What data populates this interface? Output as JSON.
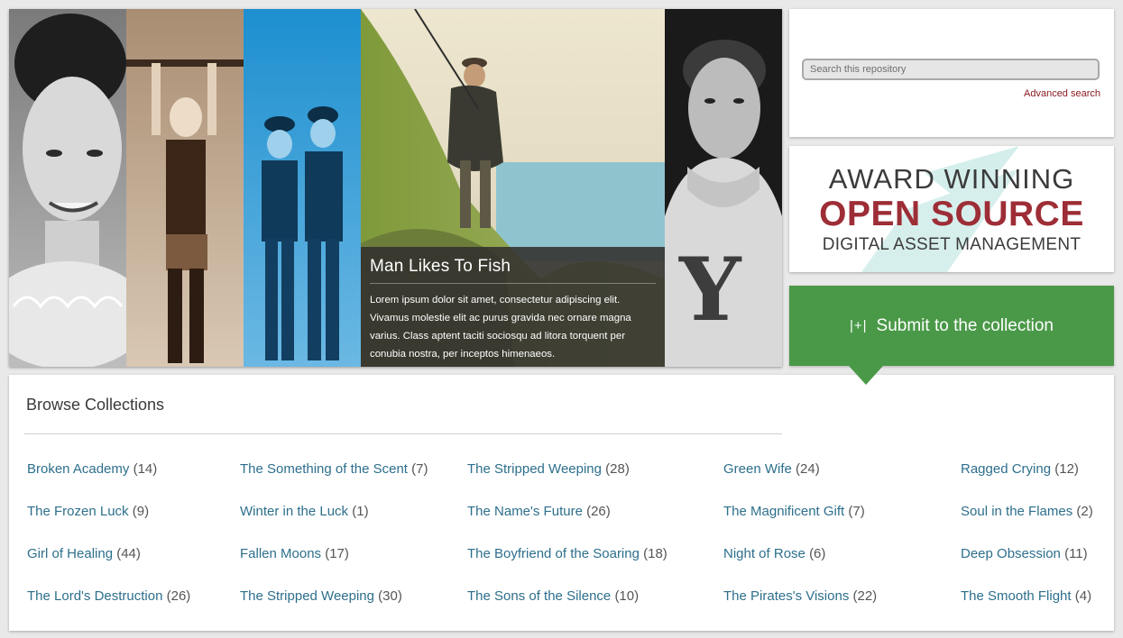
{
  "hero": {
    "panels": [
      {
        "name": "smiling-woman-photo",
        "tone": "grayscale"
      },
      {
        "name": "boy-on-bar-photo",
        "tone": "sepia"
      },
      {
        "name": "two-men-photo",
        "tone": "blue"
      },
      {
        "name": "man-fishing-photo",
        "tone": "color"
      },
      {
        "name": "yale-sweater-man-photo",
        "tone": "grayscale"
      }
    ],
    "caption": {
      "title": "Man Likes To Fish",
      "body": "Lorem ipsum dolor sit amet, consectetur adipiscing elit. Vivamus molestie elit ac purus gravida nec ornare magna varius. Class aptent taciti sociosqu ad litora torquent per conubia nostra, per inceptos himenaeos."
    },
    "sweater_letter": "Y"
  },
  "search": {
    "placeholder": "Search this repository",
    "advanced_link": "Advanced search"
  },
  "award": {
    "line1": "AWARD WINNING",
    "line2": "OPEN SOURCE",
    "line3": "DIGITAL ASSET MANAGEMENT"
  },
  "submit": {
    "icon": "|+|",
    "label": "Submit to the collection"
  },
  "browse": {
    "title": "Browse Collections",
    "columns": [
      [
        {
          "name": "Broken Academy",
          "count": "(14)"
        },
        {
          "name": "The Frozen Luck",
          "count": "(9)"
        },
        {
          "name": "Girl of Healing",
          "count": "(44)"
        },
        {
          "name": "The Lord's Destruction",
          "count": "(26)"
        }
      ],
      [
        {
          "name": "The Something of the Scent",
          "count": "(7)"
        },
        {
          "name": "Winter in the Luck",
          "count": "(1)"
        },
        {
          "name": "Fallen Moons",
          "count": "(17)"
        },
        {
          "name": "The Stripped Weeping",
          "count": "(30)"
        }
      ],
      [
        {
          "name": "The Stripped Weeping",
          "count": "(28)"
        },
        {
          "name": "The Name's Future",
          "count": "(26)"
        },
        {
          "name": "The Boyfriend of the Soaring",
          "count": "(18)"
        },
        {
          "name": "The Sons of the Silence",
          "count": "(10)"
        }
      ],
      [
        {
          "name": "Green Wife",
          "count": "(24)"
        },
        {
          "name": "The Magnificent Gift",
          "count": "(7)"
        },
        {
          "name": "Night of Rose",
          "count": "(6)"
        },
        {
          "name": "The Pirates's Visions",
          "count": "(22)"
        }
      ],
      [
        {
          "name": "Ragged Crying",
          "count": "(12)"
        },
        {
          "name": "Soul in the Flames",
          "count": "(2)"
        },
        {
          "name": "Deep Obsession",
          "count": "(11)"
        },
        {
          "name": "The Smooth Flight",
          "count": "(4)"
        }
      ]
    ]
  },
  "colors": {
    "accent_green": "#4a9948",
    "link_blue": "#2d6f8c",
    "brand_red": "#9d2d36"
  }
}
